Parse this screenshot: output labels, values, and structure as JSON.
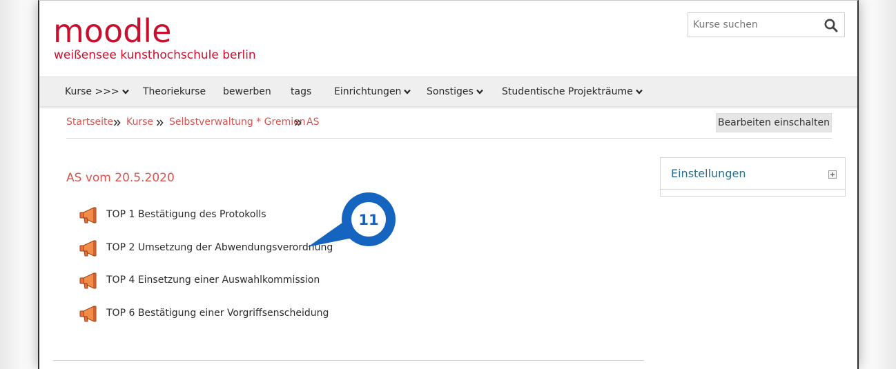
{
  "header": {
    "logo_main": "moodle",
    "logo_sub": "weißensee kunsthochschule berlin",
    "brand_color": "#c8102e"
  },
  "search": {
    "placeholder": "Kurse suchen",
    "icon": "search-icon"
  },
  "nav": {
    "items": [
      {
        "label": "Kurse >>>",
        "dropdown": true
      },
      {
        "label": "Theoriekurse",
        "dropdown": false
      },
      {
        "label": "bewerben",
        "dropdown": false
      },
      {
        "label": "tags",
        "dropdown": false
      },
      {
        "label": "Einrichtungen",
        "dropdown": true
      },
      {
        "label": "Sonstiges",
        "dropdown": true
      },
      {
        "label": "Studentische Projekträume",
        "dropdown": true
      }
    ]
  },
  "breadcrumb": {
    "items": [
      "Startseite",
      "Kurse",
      "Selbstverwaltung * Gremien",
      "AS"
    ],
    "separator_icon": "double-chevron-right-icon",
    "color": "#d9534f"
  },
  "edit_button": {
    "label": "Bearbeiten einschalten"
  },
  "section": {
    "title": "AS vom 20.5.2020",
    "activities": [
      {
        "label": "TOP 1 Bestätigung des Protokolls",
        "icon": "megaphone-icon"
      },
      {
        "label": "TOP 2 Umsetzung der Abwendungsverordnung",
        "icon": "megaphone-icon"
      },
      {
        "label": "TOP 4 Einsetzung einer Auswahlkommission",
        "icon": "megaphone-icon"
      },
      {
        "label": "TOP 6 Bestätigung einer Vorgriffsenscheidung",
        "icon": "megaphone-icon"
      }
    ]
  },
  "settings_block": {
    "title": "Einstellungen",
    "toggle_icon": "expand-plus-icon"
  },
  "callout": {
    "number": "11",
    "color": "#1565c0"
  }
}
